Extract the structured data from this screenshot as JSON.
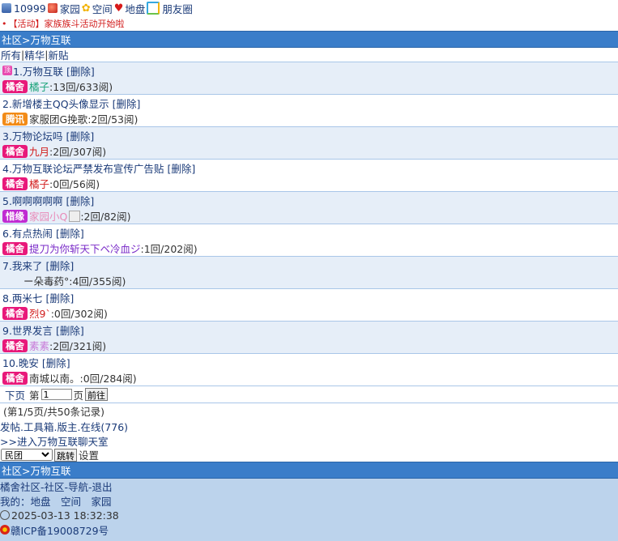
{
  "top": {
    "user_id": "10999",
    "links": [
      "家园",
      "空间",
      "地盘",
      "朋友圈"
    ]
  },
  "notice": "【活动】家族族斗活动开始啦",
  "section_title": "社区>万物互联",
  "filters": [
    "所有",
    "精华",
    "新贴"
  ],
  "posts": [
    {
      "title": "1.万物互联",
      "del": "[删除]",
      "badge": "橘舍",
      "badge_color": "#e8197a",
      "author": "橘子",
      "author_color": "#1aa37a",
      "stats": ":13回/633阅)"
    },
    {
      "title": "2.新增楼主QQ头像显示",
      "del": "[删除]",
      "badge": "腾讯",
      "badge_color": "#f28b17",
      "author": "家服团G挽歌",
      "author_color": "#333333",
      "stats": ":2回/53阅)"
    },
    {
      "title": "3.万物论坛吗",
      "del": "[删除]",
      "badge": "橘舍",
      "badge_color": "#e8197a",
      "author": "九月",
      "author_color": "#d21e1e",
      "stats": ":2回/307阅)"
    },
    {
      "title": "4.万物互联论坛严禁发布宣传广告贴",
      "del": "[删除]",
      "badge": "橘舍",
      "badge_color": "#e8197a",
      "author": "橘子",
      "author_color": "#d21e1e",
      "stats": ":0回/56阅)"
    },
    {
      "title": "5.啊啊啊啊啊",
      "del": "[删除]",
      "badge": "惜缘",
      "badge_color": "#c02bd2",
      "author": "家园小Q",
      "author_color": "#e88ab8",
      "stats": ":2回/82阅)"
    },
    {
      "title": "6.有点热闹",
      "del": "[删除]",
      "badge": "橘舍",
      "badge_color": "#e8197a",
      "author": "提刀为你斩天下ベ冷血ジ",
      "author_color": "#7a2bc8",
      "stats": ":1回/202阅)"
    },
    {
      "title": "7.我来了",
      "del": "[删除]",
      "badge": "",
      "badge_color": "",
      "author": "ー朵毒药°",
      "author_color": "#333333",
      "stats": ":4回/355阅)"
    },
    {
      "title": "8.两米七",
      "del": "[删除]",
      "badge": "橘舍",
      "badge_color": "#e8197a",
      "author": "烈9`",
      "author_color": "#d21e1e",
      "stats": ":0回/302阅)"
    },
    {
      "title": "9.世界发言",
      "del": "[删除]",
      "badge": "橘舍",
      "badge_color": "#e8197a",
      "author": "素素",
      "author_color": "#c87ad8",
      "stats": ":2回/321阅)"
    },
    {
      "title": "10.晚安",
      "del": "[删除]",
      "badge": "橘舍",
      "badge_color": "#e8197a",
      "author": "南城以南。",
      "author_color": "#333333",
      "stats": ":0回/284阅)"
    }
  ],
  "pager": {
    "next": "下页",
    "page_prefix": "第",
    "page_value": "1",
    "page_suffix": "页",
    "go": "前往"
  },
  "page_info": "(第1/5页/共50条记录)",
  "actions": "发帖.工具箱.版主.在线(776)",
  "chat_link": ">>进入万物互联聊天室",
  "select": {
    "value": "民团",
    "jump": "跳转",
    "settings": "设置"
  },
  "footer": {
    "title": "社区>万物互联",
    "nav": "橘舍社区-社区-导航-退出",
    "mine": "我的：地盘　空间　家园",
    "time": "2025-03-13 18:32:38",
    "icp": "赣ICP备19008729号"
  }
}
